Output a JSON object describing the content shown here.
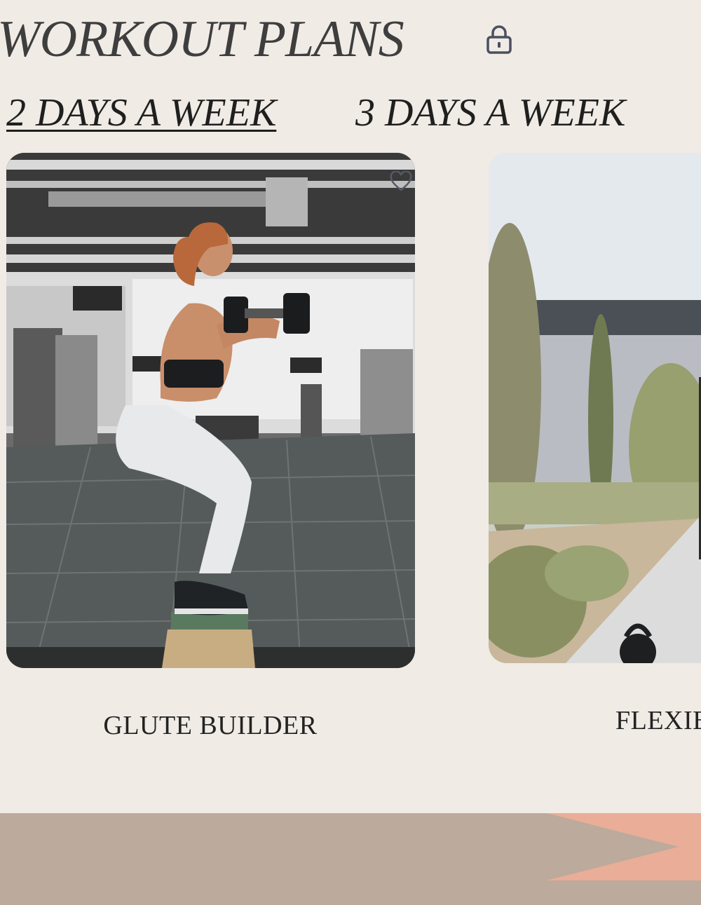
{
  "page": {
    "title": "WORKOUT PLANS",
    "lock_icon": "lock-icon"
  },
  "tabs": [
    {
      "label": "2 DAYS A WEEK",
      "active": true
    },
    {
      "label": "3 DAYS A WEEK",
      "active": false
    }
  ],
  "cards": [
    {
      "label": "GLUTE BUILDER",
      "image": "woman doing dumbbell squat on box in gym",
      "icon": "heart-icon"
    },
    {
      "label": "FLEXIB",
      "image": "outdoor path with kettlebell"
    }
  ],
  "colors": {
    "background": "#f0ebe5",
    "band": "#bcaa9c",
    "accent": "#e9ad98"
  }
}
